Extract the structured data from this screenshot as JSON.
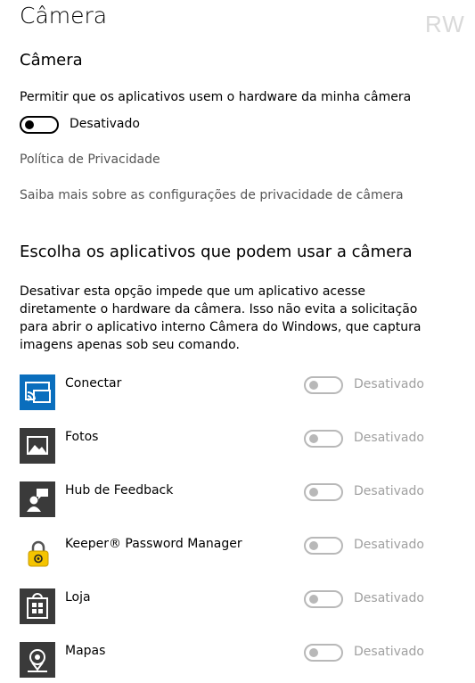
{
  "page": {
    "title": "Câmera",
    "watermark": "RW"
  },
  "section1": {
    "title": "Câmera",
    "permission_label": "Permitir que os aplicativos usem o hardware da minha câmera",
    "toggle_state": "Desativado",
    "privacy_link": "Política de Privacidade",
    "learn_more_link": "Saiba mais sobre as configurações de privacidade de câmera"
  },
  "section2": {
    "title": "Escolha os aplicativos que podem usar a câmera",
    "description": "Desativar esta opção impede que um aplicativo acesse diretamente o hardware da câmera. Isso não evita a solicitação para abrir o aplicativo interno Câmera do Windows, que captura imagens apenas sob seu comando."
  },
  "apps": [
    {
      "name": "Conectar",
      "state": "Desativado",
      "icon": "connect-icon",
      "icon_bg": "#0a6ebd"
    },
    {
      "name": "Fotos",
      "state": "Desativado",
      "icon": "photos-icon",
      "icon_bg": "#3a3a3a"
    },
    {
      "name": "Hub de Feedback",
      "state": "Desativado",
      "icon": "feedback-icon",
      "icon_bg": "#3a3a3a"
    },
    {
      "name": "Keeper® Password Manager",
      "state": "Desativado",
      "icon": "keeper-lock-icon",
      "icon_bg": "#ffffff"
    },
    {
      "name": "Loja",
      "state": "Desativado",
      "icon": "store-icon",
      "icon_bg": "#3a3a3a"
    },
    {
      "name": "Mapas",
      "state": "Desativado",
      "icon": "maps-icon",
      "icon_bg": "#3a3a3a"
    }
  ]
}
